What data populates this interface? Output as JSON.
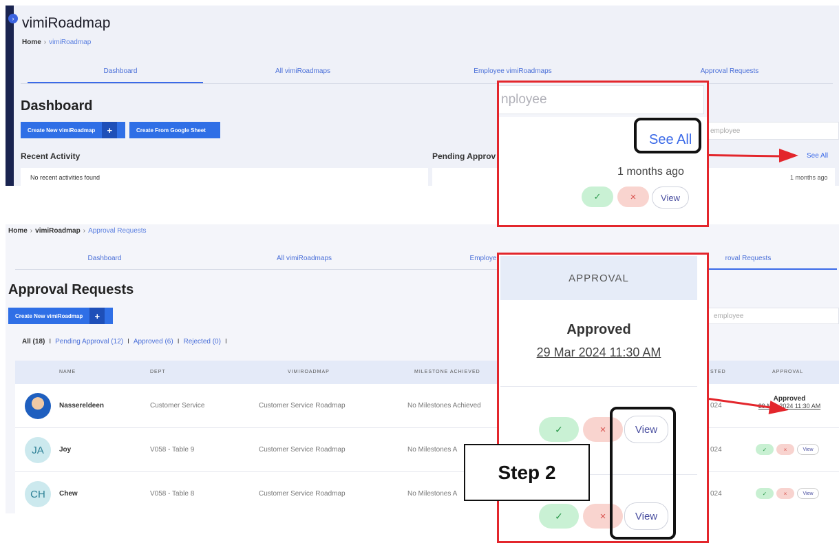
{
  "top": {
    "app_title": "vimiRoadmap",
    "breadcrumb": [
      "Home",
      "vimiRoadmap"
    ],
    "tabs": [
      "Dashboard",
      "All vimiRoadmaps",
      "Employee vimiRoadmaps",
      "Approval Requests"
    ],
    "page_title": "Dashboard",
    "buttons": {
      "create_new": "Create New vimiRoadmap",
      "create_from_sheet": "Create From Google Sheet"
    },
    "recent_activity": {
      "title": "Recent Activity",
      "empty": "No recent activities found"
    },
    "pending_title": "Pending Approv",
    "search_placeholder": "employee",
    "see_all": "See All",
    "time_ago": "1 months ago"
  },
  "zoom_top": {
    "input_placeholder": "nployee",
    "see_all": "See All",
    "time_ago": "1 months ago",
    "approve_icon": "✓",
    "reject_icon": "×",
    "view": "View"
  },
  "bottom": {
    "breadcrumb": [
      "Home",
      "vimiRoadmap",
      "Approval Requests"
    ],
    "tabs": [
      "Dashboard",
      "All vimiRoadmaps",
      "Employe",
      "roval Requests"
    ],
    "page_title": "Approval Requests",
    "create_new": "Create New vimiRoadmap",
    "filters": {
      "all": "All (18)",
      "pending": "Pending Approval (12)",
      "approved": "Approved (6)",
      "rejected": "Rejected (0)"
    },
    "search_placeholder": "employee",
    "columns": [
      "NAME",
      "DEPT",
      "VIMIROADMAP",
      "MILESTONE ACHIEVED",
      "STED",
      "APPROVAL"
    ],
    "rows": [
      {
        "name": "Nassereldeen",
        "dept": "Customer Service",
        "roadmap": "Customer Service Roadmap",
        "milestone": "No Milestones Achieved",
        "date": "024",
        "approval_status": "Approved",
        "approval_date": "29 Mar 2024 11:30 AM"
      },
      {
        "initials": "JA",
        "name": "Joy",
        "dept": "V058 - Table 9",
        "roadmap": "Customer Service Roadmap",
        "milestone": "No Milestones A",
        "date": "024",
        "view": "View"
      },
      {
        "initials": "CH",
        "name": "Chew",
        "dept": "V058 - Table 8",
        "roadmap": "Customer Service Roadmap",
        "milestone": "No Milestones A",
        "date": "024",
        "view": "View"
      }
    ]
  },
  "zoom_bottom": {
    "header": "APPROVAL",
    "status": "Approved",
    "date": "29 Mar 2024 11:30 AM",
    "approve_icon": "✓",
    "reject_icon": "×",
    "view": "View"
  },
  "step_label": "Step 2",
  "colors": {
    "highlight_red": "#e3262c",
    "primary_blue": "#2f6fe6",
    "rail": "#1a2450"
  }
}
